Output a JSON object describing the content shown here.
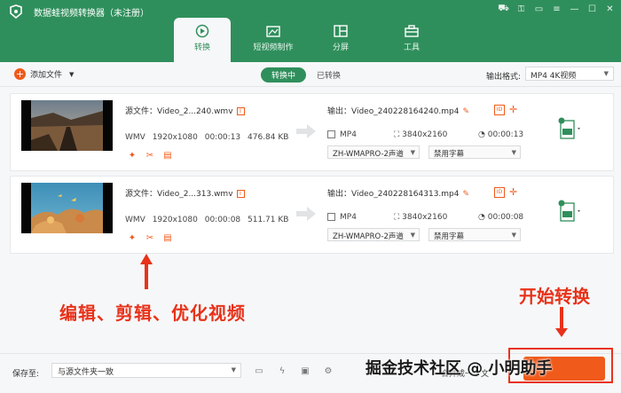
{
  "window": {
    "title": "数据蛙视频转换器（未注册）"
  },
  "tabs": [
    {
      "label": "转换"
    },
    {
      "label": "短视频制作"
    },
    {
      "label": "分屏"
    },
    {
      "label": "工具"
    }
  ],
  "toolbar": {
    "add_label": "添加文件",
    "seg_converting": "转换中",
    "seg_converted": "已转换",
    "output_format_label": "输出格式:",
    "output_format_value": "MP4 4K视频"
  },
  "items": [
    {
      "source": "源文件：Video_2...240.wmv",
      "codec": "WMV",
      "resolution": "1920x1080",
      "duration": "00:00:13",
      "size": "476.84 KB",
      "output": "输出：Video_240228164240.mp4",
      "out_format": "MP4",
      "out_resolution": "3840x2160",
      "out_duration": "00:00:13",
      "audio": "ZH-WMAPRO-2声道",
      "subtitle": "禁用字幕"
    },
    {
      "source": "源文件：Video_2...313.wmv",
      "codec": "WMV",
      "resolution": "1920x1080",
      "duration": "00:00:08",
      "size": "511.71 KB",
      "output": "输出：Video_240228164313.mp4",
      "out_format": "MP4",
      "out_resolution": "3840x2160",
      "out_duration": "00:00:08",
      "audio": "ZH-WMAPRO-2声道",
      "subtitle": "禁用字幕"
    }
  ],
  "annotations": {
    "edit": "编辑、剪辑、优化视频",
    "start": "开始转换"
  },
  "bottom": {
    "save_label": "保存至:",
    "save_value": "与源文件夹一致",
    "merge_label": "合并成一个文",
    "watermark": "掘金技术社区 @ 小明助手"
  },
  "colors": {
    "brand_green": "#2f8f5c",
    "accent_orange": "#f05a1a",
    "annotation_red": "#e8321a"
  }
}
